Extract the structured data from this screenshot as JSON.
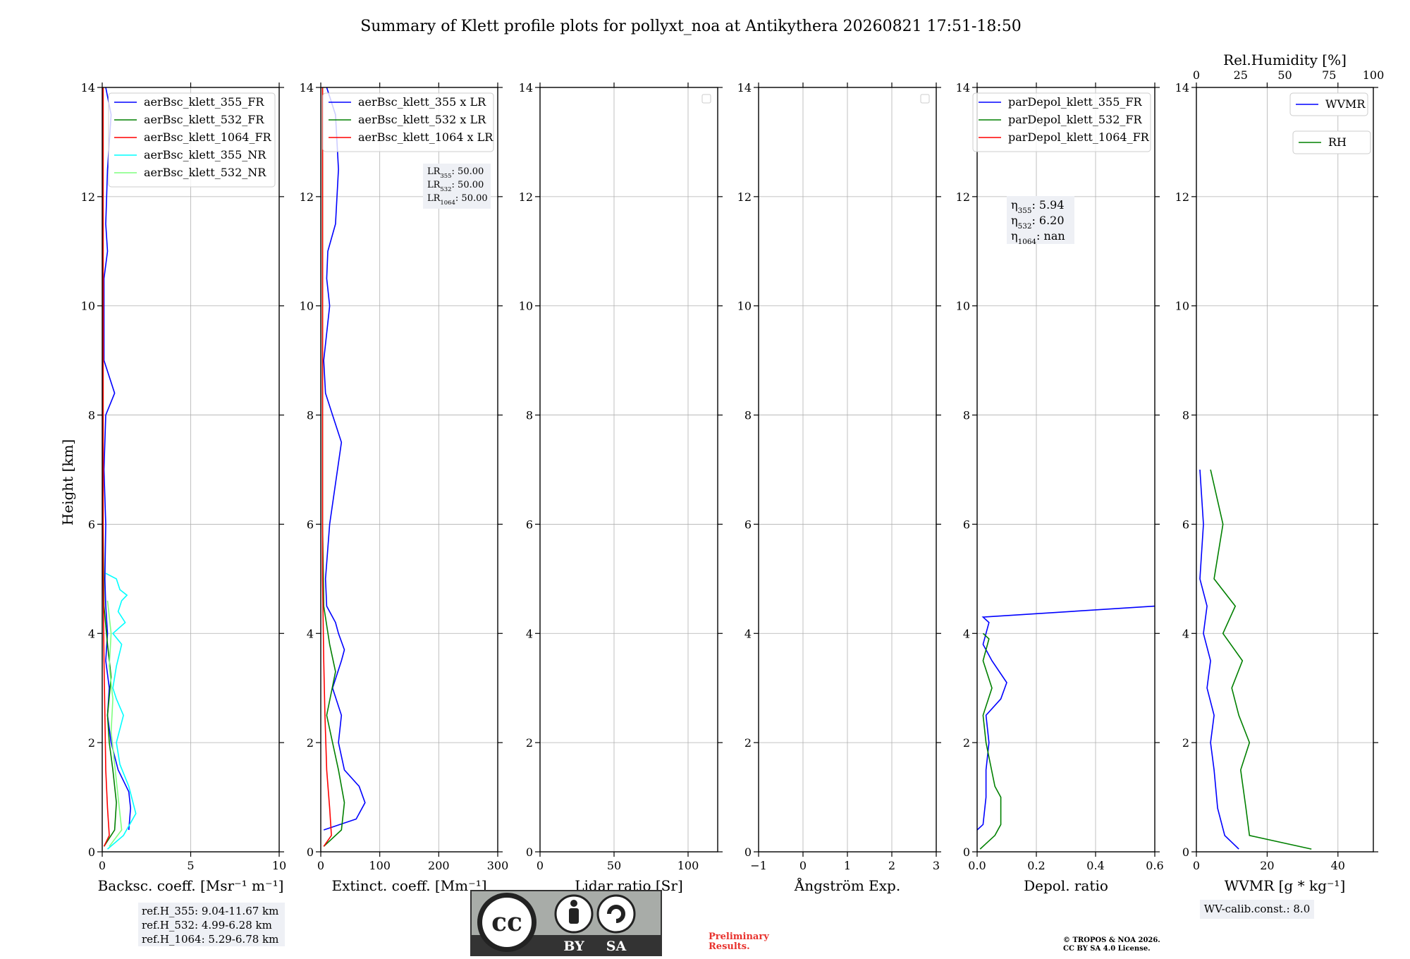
{
  "figure": {
    "title": "Summary of Klett profile plots for pollyxt_noa at Antikythera 20260821 17:51-18:50",
    "y_axis_label": "Height [km]"
  },
  "panels": [
    {
      "id": "bsc",
      "xlabel": "Backsc. coeff. [Msr⁻¹ m⁻¹]",
      "xticks": [
        "0",
        "5",
        "10"
      ],
      "legend": [
        "aerBsc_klett_355_FR",
        "aerBsc_klett_532_FR",
        "aerBsc_klett_1064_FR",
        "aerBsc_klett_355_NR",
        "aerBsc_klett_532_NR"
      ]
    },
    {
      "id": "ext",
      "xlabel": "Extinct. coeff. [Mm⁻¹]",
      "xticks": [
        "0",
        "100",
        "200",
        "300"
      ],
      "legend": [
        "aerBsc_klett_355 x LR",
        "aerBsc_klett_532 x LR",
        "aerBsc_klett_1064 x LR"
      ]
    },
    {
      "id": "lr",
      "xlabel": "Lidar ratio [Sr]",
      "xticks": [
        "0",
        "50",
        "100"
      ],
      "legend": []
    },
    {
      "id": "ae",
      "xlabel": "Ångström Exp.",
      "xticks": [
        "−1",
        "0",
        "1",
        "2",
        "3"
      ],
      "legend": []
    },
    {
      "id": "depol",
      "xlabel": "Depol. ratio",
      "xticks": [
        "0.0",
        "0.2",
        "0.4",
        "0.6"
      ],
      "legend": [
        "parDepol_klett_355_FR",
        "parDepol_klett_532_FR",
        "parDepol_klett_1064_FR"
      ]
    },
    {
      "id": "wv",
      "xlabel": "WVMR [g * kg⁻¹]",
      "xticks": [
        "0",
        "20",
        "40"
      ],
      "top_label": "Rel.Humidity [%]",
      "top_ticks": [
        "0",
        "25",
        "50",
        "75",
        "100"
      ],
      "legend": [
        "WVMR",
        "RH"
      ]
    }
  ],
  "annotations": {
    "lidar_ratio": {
      "lines": [
        [
          "LR",
          "355",
          ": 50.00"
        ],
        [
          "LR",
          "532",
          ": 50.00"
        ],
        [
          "LR",
          "1064",
          ": 50.00"
        ]
      ]
    },
    "eta": {
      "lines": [
        [
          "η",
          "355",
          ": 5.94"
        ],
        [
          "η",
          "532",
          ": 6.20"
        ],
        [
          "η",
          "1064",
          ": nan"
        ]
      ]
    },
    "ref_height": [
      "ref.H_355: 9.04-11.67 km",
      "ref.H_532: 4.99-6.28 km",
      "ref.H_1064: 5.29-6.78 km"
    ],
    "wv_calib": "WV-calib.const.: 8.0",
    "preliminary": [
      "Preliminary",
      "Results."
    ],
    "copyright": [
      "© TROPOS & NOA 2026.",
      "CC BY SA 4.0 License."
    ],
    "license_badge": [
      "BY",
      "SA"
    ]
  },
  "colors": {
    "c355": "#0000ff",
    "c532": "#008000",
    "c1064": "#ff0000",
    "c355nr": "#00ffff",
    "c532nr": "#7fff7f",
    "grid": "#b0b0b0"
  },
  "chart_data": [
    {
      "type": "line",
      "title": "",
      "xlabel": "Backsc. coeff. [Msr⁻¹ m⁻¹]",
      "ylabel": "Height [km]",
      "xlim": [
        0,
        10
      ],
      "ylim": [
        0,
        14
      ],
      "grid": true,
      "legend": "top-right",
      "series": [
        {
          "name": "aerBsc_klett_355_FR",
          "color": "#0000ff",
          "x": [
            1.5,
            1.6,
            1.5,
            0.9,
            0.5,
            0.3,
            0.4,
            0.2,
            0.3,
            0.2,
            0.15,
            0.2,
            0.1,
            0.2,
            0.7,
            0.1,
            0.1,
            0.1,
            0.3,
            0.2,
            0.3,
            0.5,
            0.2
          ],
          "y": [
            0.4,
            0.8,
            1.1,
            1.5,
            2.0,
            2.5,
            3.0,
            3.5,
            4.0,
            4.5,
            5.0,
            6.0,
            7.0,
            8.0,
            8.4,
            9.0,
            10.0,
            10.5,
            11.0,
            11.5,
            12.5,
            13.5,
            14.0
          ]
        },
        {
          "name": "aerBsc_klett_532_FR",
          "color": "#008000",
          "x": [
            0.1,
            0.7,
            0.8,
            0.6,
            0.4,
            0.3,
            0.5,
            0.3,
            0.1,
            0.05,
            0.05,
            0.05,
            0.05
          ],
          "y": [
            0.1,
            0.4,
            0.9,
            1.5,
            2.0,
            2.5,
            3.2,
            3.8,
            4.5,
            6.0,
            8.0,
            11.0,
            14.0
          ]
        },
        {
          "name": "aerBsc_klett_1064_FR",
          "color": "#ff0000",
          "x": [
            0.1,
            0.4,
            0.3,
            0.2,
            0.15,
            0.1,
            0.05,
            0.05,
            0.05
          ],
          "y": [
            0.1,
            0.3,
            0.8,
            1.5,
            2.5,
            3.5,
            5.0,
            9.0,
            14.0
          ]
        },
        {
          "name": "aerBsc_klett_355_NR",
          "color": "#00ffff",
          "x": [
            0.3,
            1.2,
            1.9,
            1.5,
            1.0,
            0.8,
            1.2,
            0.8,
            0.6,
            0.8,
            1.1,
            0.6,
            1.3,
            0.9,
            1.1,
            1.4,
            1.0,
            0.8,
            0.2
          ],
          "y": [
            0.05,
            0.3,
            0.7,
            1.2,
            1.6,
            2.0,
            2.5,
            2.8,
            3.0,
            3.4,
            3.8,
            4.0,
            4.2,
            4.4,
            4.6,
            4.7,
            4.8,
            5.0,
            5.1
          ]
        },
        {
          "name": "aerBsc_klett_532_NR",
          "color": "#7fff7f",
          "x": [
            0.4,
            1.1,
            0.9,
            0.7,
            0.5,
            0.6,
            0.4,
            0.5,
            0.3
          ],
          "y": [
            0.1,
            0.4,
            1.0,
            1.6,
            2.2,
            2.8,
            3.4,
            4.0,
            4.6
          ]
        }
      ]
    },
    {
      "type": "line",
      "title": "",
      "xlabel": "Extinct. coeff. [Mm⁻¹]",
      "ylabel": "",
      "xlim": [
        0,
        300
      ],
      "ylim": [
        0,
        14
      ],
      "grid": true,
      "legend": "top-right",
      "series": [
        {
          "name": "aerBsc_klett_355 x LR",
          "color": "#0000ff",
          "x": [
            5,
            60,
            75,
            65,
            40,
            30,
            35,
            20,
            35,
            40,
            30,
            25,
            10,
            8,
            15,
            35,
            20,
            8,
            5,
            10,
            15,
            10,
            12,
            25,
            30,
            25,
            10
          ],
          "y": [
            0.4,
            0.6,
            0.9,
            1.2,
            1.5,
            2.0,
            2.5,
            3.0,
            3.5,
            3.7,
            4.0,
            4.2,
            4.5,
            5.0,
            6.0,
            7.5,
            8.0,
            8.4,
            9.0,
            9.5,
            10.0,
            10.5,
            11.0,
            11.5,
            12.5,
            13.5,
            14.0
          ]
        },
        {
          "name": "aerBsc_klett_532 x LR",
          "color": "#008000",
          "x": [
            5,
            35,
            40,
            30,
            20,
            10,
            25,
            15,
            5,
            3,
            3,
            3,
            3
          ],
          "y": [
            0.1,
            0.4,
            0.9,
            1.5,
            2.0,
            2.5,
            3.3,
            3.8,
            4.5,
            6.0,
            8.0,
            11.0,
            14.0
          ]
        },
        {
          "name": "aerBsc_klett_1064 x LR",
          "color": "#ff0000",
          "x": [
            5,
            18,
            15,
            10,
            7,
            5,
            3,
            3,
            3
          ],
          "y": [
            0.1,
            0.3,
            0.8,
            1.5,
            2.5,
            3.5,
            5.0,
            9.0,
            14.0
          ]
        }
      ]
    },
    {
      "type": "line",
      "title": "",
      "xlabel": "Lidar ratio [Sr]",
      "ylabel": "",
      "xlim": [
        0,
        120
      ],
      "ylim": [
        0,
        14
      ],
      "grid": true,
      "legend": "top-right",
      "series": []
    },
    {
      "type": "line",
      "title": "",
      "xlabel": "Ångström Exp.",
      "ylabel": "",
      "xlim": [
        -1,
        3
      ],
      "ylim": [
        0,
        14
      ],
      "grid": true,
      "legend": "top-right",
      "series": []
    },
    {
      "type": "line",
      "title": "",
      "xlabel": "Depol. ratio",
      "ylabel": "",
      "xlim": [
        0,
        0.6
      ],
      "ylim": [
        0,
        14
      ],
      "grid": true,
      "legend": "top-right",
      "series": [
        {
          "name": "parDepol_klett_355_FR",
          "color": "#0000ff",
          "x": [
            0.0,
            0.02,
            0.03,
            0.03,
            0.04,
            0.03,
            0.08,
            0.1,
            0.05,
            0.02,
            0.04,
            0.02,
            0.6
          ],
          "y": [
            0.4,
            0.5,
            1.0,
            1.5,
            2.0,
            2.5,
            2.8,
            3.1,
            3.5,
            3.8,
            4.2,
            4.3,
            4.5
          ]
        },
        {
          "name": "parDepol_klett_532_FR",
          "color": "#008000",
          "x": [
            0.01,
            0.06,
            0.08,
            0.08,
            0.06,
            0.03,
            0.02,
            0.05,
            0.02,
            0.04,
            0.02
          ],
          "y": [
            0.05,
            0.3,
            0.5,
            1.0,
            1.2,
            2.0,
            2.5,
            3.0,
            3.5,
            3.9,
            4.0
          ]
        },
        {
          "name": "parDepol_klett_1064_FR",
          "color": "#ff0000",
          "x": [],
          "y": []
        }
      ]
    },
    {
      "type": "line",
      "title": "",
      "xlabel": "WVMR [g * kg⁻¹]",
      "ylabel": "",
      "xlim": [
        0,
        50
      ],
      "ylim": [
        0,
        14
      ],
      "grid": true,
      "legend": "top-right",
      "x2label": "Rel.Humidity [%]",
      "x2lim": [
        0,
        100
      ],
      "series": [
        {
          "name": "WVMR",
          "color": "#0000ff",
          "x": [
            12,
            8,
            6,
            5,
            4,
            5,
            3,
            4,
            2,
            3,
            1,
            2,
            1
          ],
          "y": [
            0.05,
            0.3,
            0.8,
            1.5,
            2.0,
            2.5,
            3.0,
            3.5,
            4.0,
            4.5,
            5.0,
            6.0,
            7.0
          ]
        },
        {
          "name": "RH",
          "color": "#008000",
          "x": [
            65,
            30,
            28,
            25,
            30,
            24,
            20,
            26,
            15,
            22,
            10,
            15,
            8
          ],
          "y": [
            0.05,
            0.3,
            0.8,
            1.5,
            2.0,
            2.5,
            3.0,
            3.5,
            4.0,
            4.5,
            5.0,
            6.0,
            7.0
          ]
        }
      ]
    }
  ]
}
